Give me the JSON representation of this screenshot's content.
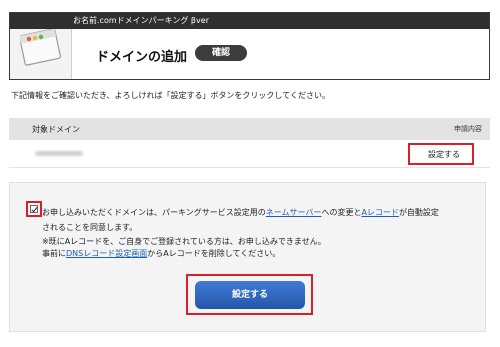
{
  "header": {
    "bar_title": "お名前.comドメインパーキング βver",
    "title": "ドメインの追加",
    "badge": "確認"
  },
  "intro_text": "下記情報をご確認いただき、よろしければ「設定する」ボタンをクリックしてください。",
  "table": {
    "col_domain": "対象ドメイン",
    "col_request": "申請内容",
    "rows": [
      {
        "action": "設定する"
      }
    ]
  },
  "consent": {
    "checked": true,
    "line1_a": "お申し込みいただくドメインは、パーキングサービス設定用の",
    "line1_link1": "ネームサーバー",
    "line1_b": "への変更と",
    "line1_link2": "Aレコード",
    "line1_c": "が自動設定",
    "line2": "されることを同意します。",
    "line3": "※既にAレコードを、ご自身でご登録されている方は、お申し込みできません。",
    "line4_a": "事前に",
    "line4_link": "DNSレコード設定画面",
    "line4_b": "からAレコードを削除してください。"
  },
  "submit_label": "設定する",
  "colors": {
    "highlight": "#d6202a",
    "button": "#2f66bf",
    "link": "#1a5fb4"
  }
}
